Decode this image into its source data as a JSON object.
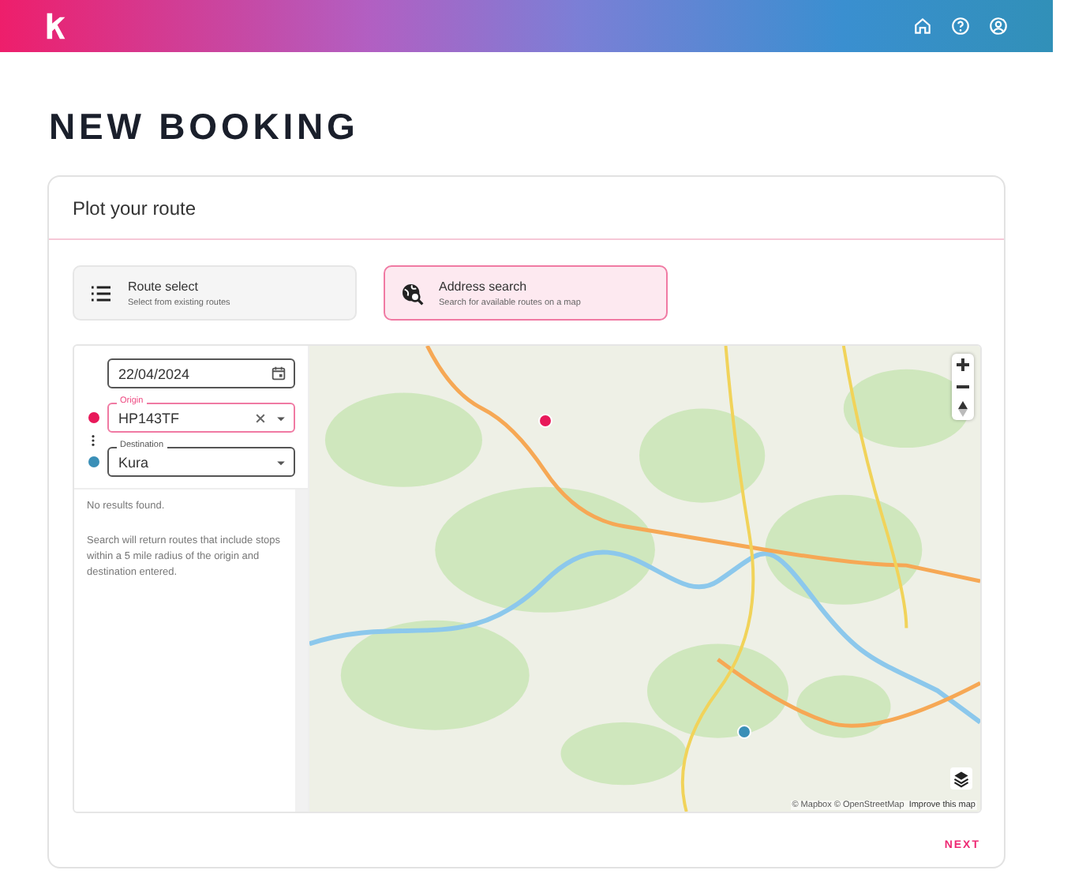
{
  "page_title": "NEW BOOKING",
  "card": {
    "title": "Plot your route",
    "modes": [
      {
        "kind": "list",
        "title": "Route select",
        "subtitle": "Select from existing routes",
        "selected": false
      },
      {
        "kind": "map",
        "title": "Address search",
        "subtitle": "Search for available routes on a map",
        "selected": true
      }
    ],
    "date": {
      "value": "22/04/2024"
    },
    "stops": [
      {
        "label": "Origin",
        "value": "HP143TF",
        "color": "#e8195a",
        "focused": true,
        "clearable": true
      },
      {
        "label": "Destination",
        "value": "Kura",
        "color": "#3a8fb7",
        "focused": false,
        "clearable": false
      }
    ],
    "results": {
      "message": "No results found.",
      "hint": "Search will return routes that include stops within a 5 mile radius of the origin and destination entered."
    },
    "map": {
      "attribution": "© Mapbox © OpenStreetMap",
      "improve_link": "Improve this map"
    },
    "next_button": "NEXT"
  }
}
